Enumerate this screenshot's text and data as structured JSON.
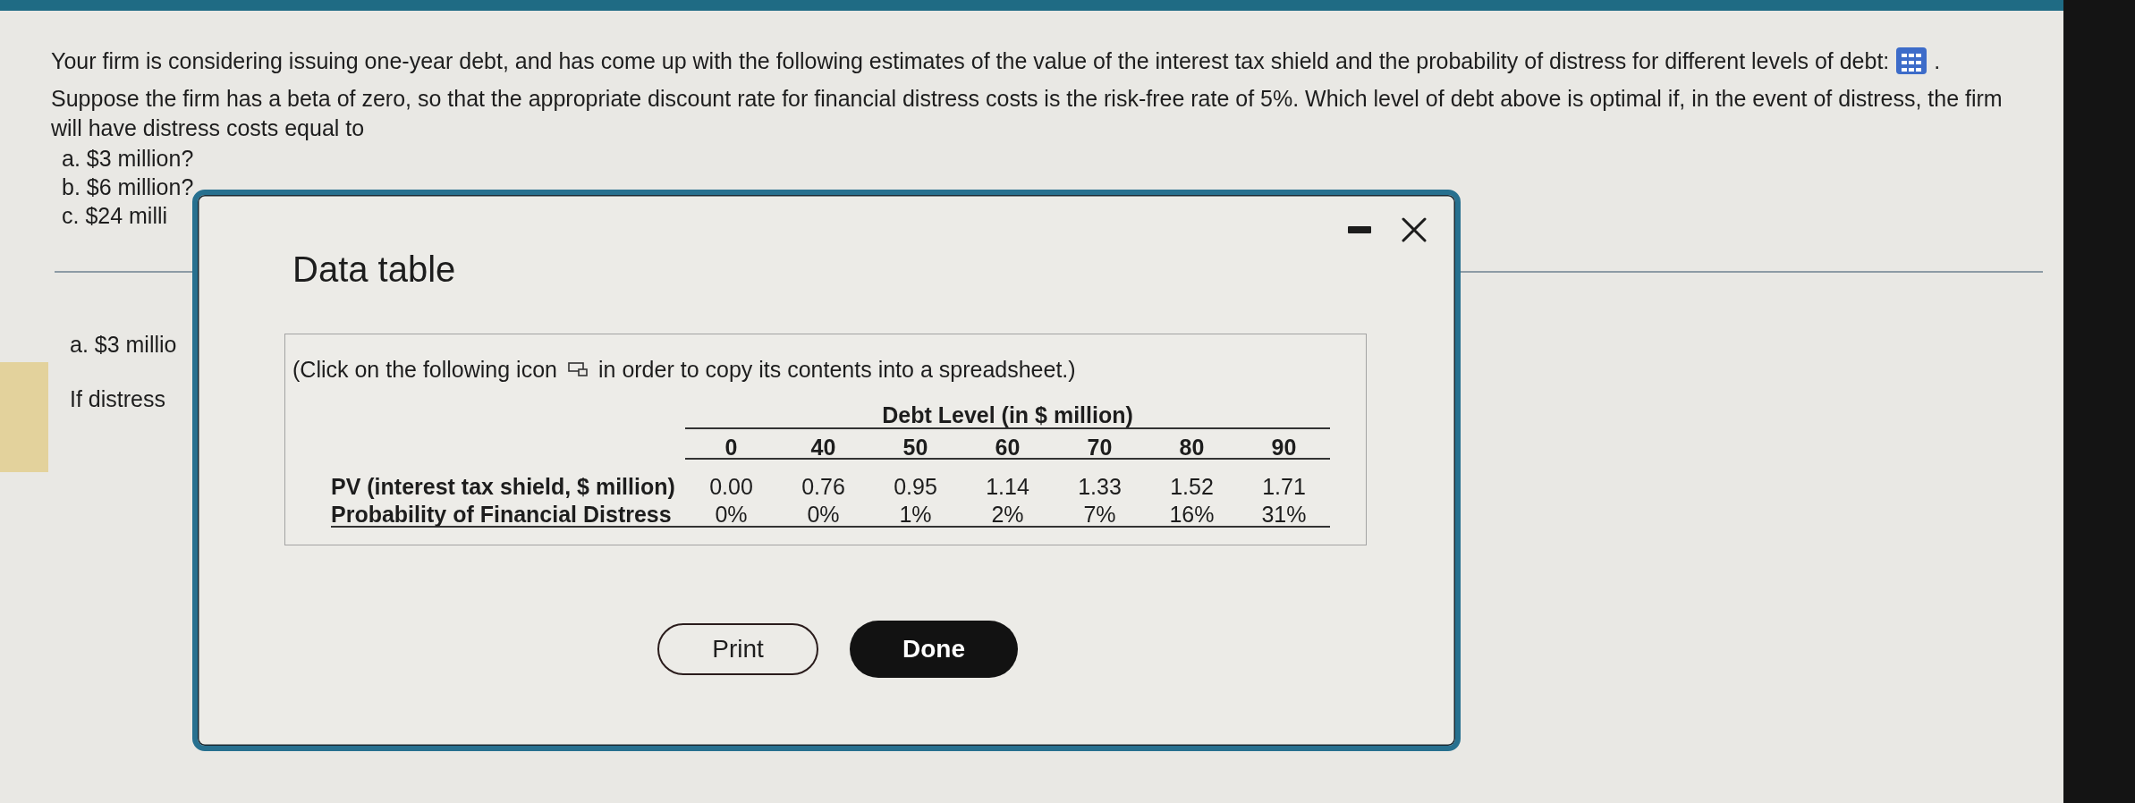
{
  "question": {
    "intro": "Your firm is considering issuing one-year debt, and has come up with the following estimates of the value of the interest tax shield and the probability of distress for different levels of debt:",
    "intro_end": ".",
    "body": "Suppose the firm has a beta of zero, so that the appropriate discount rate for financial distress costs is the risk-free rate of 5%. Which level of debt above is optimal if, in the event of distress, the firm will have distress costs equal to",
    "parts": [
      "a. $3 million?",
      "b. $6 million?",
      "c. $24 milli"
    ]
  },
  "answer_area": {
    "part_label": "a. $3 millio",
    "prompt": "If distress"
  },
  "dialog": {
    "title": "Data table",
    "instruction_before": "(Click on the following icon",
    "instruction_after": "in order to copy its contents into a spreadsheet.)",
    "table": {
      "group_header": "Debt Level (in $ million)",
      "columns": [
        "0",
        "40",
        "50",
        "60",
        "70",
        "80",
        "90"
      ],
      "rows": [
        {
          "label": "PV (interest tax shield, $ million)",
          "values": [
            "0.00",
            "0.76",
            "0.95",
            "1.14",
            "1.33",
            "1.52",
            "1.71"
          ]
        },
        {
          "label": "Probability of Financial Distress",
          "values": [
            "0%",
            "0%",
            "1%",
            "2%",
            "7%",
            "16%",
            "31%"
          ]
        }
      ]
    },
    "buttons": [
      {
        "label": "Print",
        "kind": "secondary"
      },
      {
        "label": "Done",
        "kind": "primary"
      }
    ]
  }
}
